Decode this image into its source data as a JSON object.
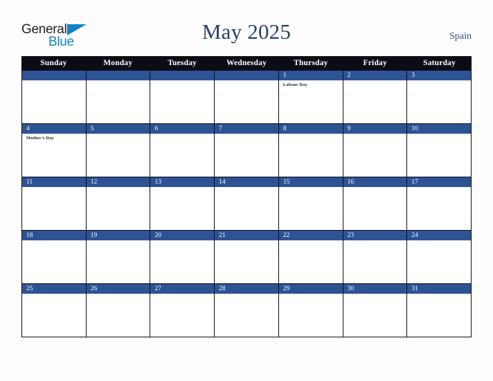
{
  "logo": {
    "word1": "General",
    "word2": "Blue",
    "triangle_icon": "blue-triangle-icon",
    "color_black": "#231f20",
    "color_blue": "#1481c4"
  },
  "header": {
    "title": "May 2025",
    "country": "Spain",
    "title_color": "#2b3f66",
    "country_color": "#3a4f7a"
  },
  "calendar": {
    "weekday_header_bg": "#0b0c16",
    "day_bar_bg": "#2e5395",
    "weekdays": [
      "Sunday",
      "Monday",
      "Tuesday",
      "Wednesday",
      "Thursday",
      "Friday",
      "Saturday"
    ],
    "weeks": [
      [
        {
          "date": "",
          "blank": true,
          "events": []
        },
        {
          "date": "",
          "blank": true,
          "events": []
        },
        {
          "date": "",
          "blank": true,
          "events": []
        },
        {
          "date": "",
          "blank": true,
          "events": []
        },
        {
          "date": "1",
          "blank": false,
          "events": [
            "Labour Day"
          ]
        },
        {
          "date": "2",
          "blank": false,
          "events": []
        },
        {
          "date": "3",
          "blank": false,
          "events": []
        }
      ],
      [
        {
          "date": "4",
          "blank": false,
          "events": [
            "Mother’s Day"
          ]
        },
        {
          "date": "5",
          "blank": false,
          "events": []
        },
        {
          "date": "6",
          "blank": false,
          "events": []
        },
        {
          "date": "7",
          "blank": false,
          "events": []
        },
        {
          "date": "8",
          "blank": false,
          "events": []
        },
        {
          "date": "9",
          "blank": false,
          "events": []
        },
        {
          "date": "10",
          "blank": false,
          "events": []
        }
      ],
      [
        {
          "date": "11",
          "blank": false,
          "events": []
        },
        {
          "date": "12",
          "blank": false,
          "events": []
        },
        {
          "date": "13",
          "blank": false,
          "events": []
        },
        {
          "date": "14",
          "blank": false,
          "events": []
        },
        {
          "date": "15",
          "blank": false,
          "events": []
        },
        {
          "date": "16",
          "blank": false,
          "events": []
        },
        {
          "date": "17",
          "blank": false,
          "events": []
        }
      ],
      [
        {
          "date": "18",
          "blank": false,
          "events": []
        },
        {
          "date": "19",
          "blank": false,
          "events": []
        },
        {
          "date": "20",
          "blank": false,
          "events": []
        },
        {
          "date": "21",
          "blank": false,
          "events": []
        },
        {
          "date": "22",
          "blank": false,
          "events": []
        },
        {
          "date": "23",
          "blank": false,
          "events": []
        },
        {
          "date": "24",
          "blank": false,
          "events": []
        }
      ],
      [
        {
          "date": "25",
          "blank": false,
          "events": []
        },
        {
          "date": "26",
          "blank": false,
          "events": []
        },
        {
          "date": "27",
          "blank": false,
          "events": []
        },
        {
          "date": "28",
          "blank": false,
          "events": []
        },
        {
          "date": "29",
          "blank": false,
          "events": []
        },
        {
          "date": "30",
          "blank": false,
          "events": []
        },
        {
          "date": "31",
          "blank": false,
          "events": []
        }
      ]
    ]
  }
}
